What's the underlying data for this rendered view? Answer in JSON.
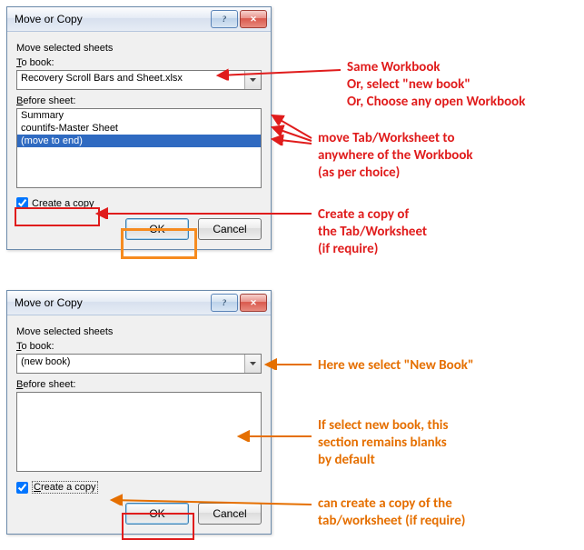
{
  "dialog1": {
    "title": "Move or Copy",
    "instruction": "Move selected sheets",
    "to_book_label": "To book:",
    "to_book_value": "Recovery Scroll Bars and Sheet.xlsx",
    "before_sheet_label": "Before sheet:",
    "sheets": [
      "Summary",
      "countifs-Master Sheet",
      "(move to end)"
    ],
    "selected_index": 2,
    "create_copy_label": "Create a copy",
    "create_copy_checked": true,
    "ok_label": "OK",
    "cancel_label": "Cancel"
  },
  "dialog2": {
    "title": "Move or Copy",
    "instruction": "Move selected sheets",
    "to_book_label": "To book:",
    "to_book_value": "(new book)",
    "before_sheet_label": "Before sheet:",
    "sheets": [],
    "create_copy_label": "Create a copy",
    "create_copy_checked": true,
    "ok_label": "OK",
    "cancel_label": "Cancel"
  },
  "annotations": {
    "a1_line1": "Same Workbook",
    "a1_line2": "Or, select \"new book\"",
    "a1_line3": "Or, Choose any open Workbook",
    "a2_line1": "move Tab/Worksheet to",
    "a2_line2": "anywhere of the Workbook",
    "a2_line3": "(as per choice)",
    "a3_line1": "Create a copy of",
    "a3_line2": "the Tab/Worksheet",
    "a3_line3": "(if require)",
    "b1": "Here we select \"New Book\"",
    "b2_line1": "If select new book, this",
    "b2_line2": "section remains blanks",
    "b2_line3": "by default",
    "b3_line1": "can create a copy of the",
    "b3_line2": "tab/worksheet (if require)"
  }
}
